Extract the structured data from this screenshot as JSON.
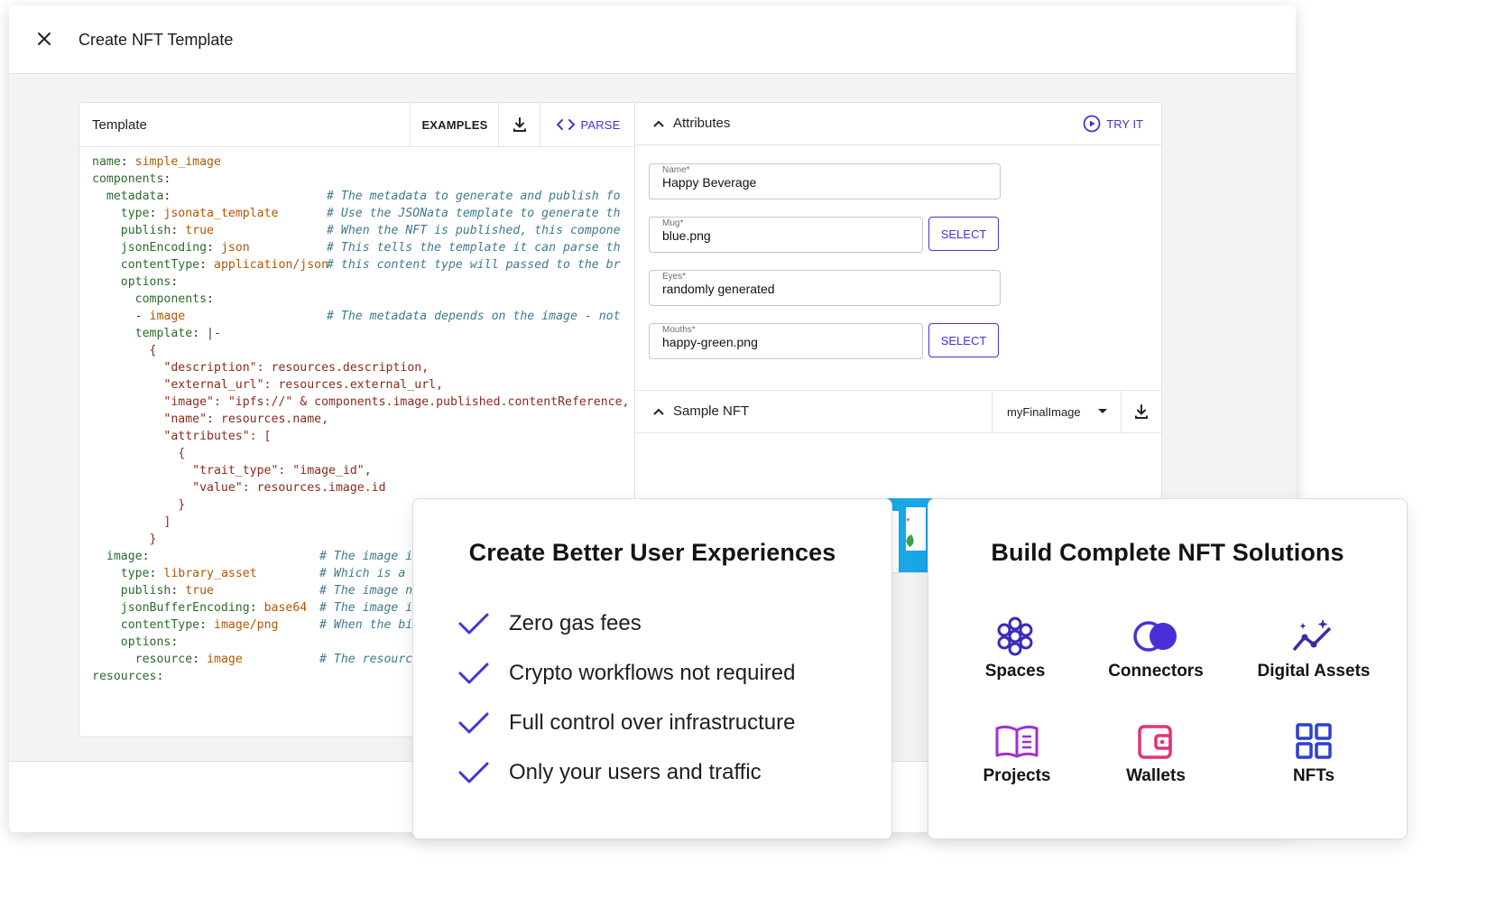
{
  "dialog": {
    "title": "Create NFT Template"
  },
  "template_panel": {
    "title": "Template",
    "examples_label": "EXAMPLES",
    "parse_label": "PARSE",
    "code": [
      [
        [
          "k",
          "name"
        ],
        [
          "p",
          ": "
        ],
        [
          "v",
          "simple_image"
        ]
      ],
      [
        [
          "k",
          "components"
        ],
        [
          "p",
          ":"
        ]
      ],
      [
        [
          "p",
          "  "
        ],
        [
          "k",
          "metadata"
        ],
        [
          "p",
          ":"
        ],
        [
          "c",
          "# The metadata to generate and publish fo",
          260
        ]
      ],
      [
        [
          "p",
          "    "
        ],
        [
          "k",
          "type"
        ],
        [
          "p",
          ": "
        ],
        [
          "v",
          "jsonata_template"
        ],
        [
          "c",
          "# Use the JSONata template to generate th",
          260
        ]
      ],
      [
        [
          "p",
          "    "
        ],
        [
          "k",
          "publish"
        ],
        [
          "p",
          ": "
        ],
        [
          "v",
          "true"
        ],
        [
          "c",
          "# When the NFT is published, this compone",
          260
        ]
      ],
      [
        [
          "p",
          "    "
        ],
        [
          "k",
          "jsonEncoding"
        ],
        [
          "p",
          ": "
        ],
        [
          "v",
          "json"
        ],
        [
          "c",
          "# This tells the template it can parse th",
          260
        ]
      ],
      [
        [
          "p",
          "    "
        ],
        [
          "k",
          "contentType"
        ],
        [
          "p",
          ": "
        ],
        [
          "v",
          "application/json"
        ],
        [
          "c",
          "# this content type will passed to the br",
          260
        ]
      ],
      [
        [
          "p",
          "    "
        ],
        [
          "k",
          "options"
        ],
        [
          "p",
          ":"
        ]
      ],
      [
        [
          "p",
          "      "
        ],
        [
          "k",
          "components"
        ],
        [
          "p",
          ":"
        ]
      ],
      [
        [
          "p",
          "      - "
        ],
        [
          "v",
          "image"
        ],
        [
          "c",
          "# The metadata depends on the image - not",
          260
        ]
      ],
      [
        [
          "p",
          "      "
        ],
        [
          "k",
          "template"
        ],
        [
          "p",
          ": |-"
        ]
      ],
      [
        [
          "p",
          "        "
        ],
        [
          "s",
          "{"
        ]
      ],
      [
        [
          "p",
          "          "
        ],
        [
          "s",
          "\"description\": resources.description,"
        ]
      ],
      [
        [
          "p",
          "          "
        ],
        [
          "s",
          "\"external_url\": resources.external_url,"
        ]
      ],
      [
        [
          "p",
          "          "
        ],
        [
          "s",
          "\"image\": \"ipfs://\" & components.image.published.contentReference,"
        ]
      ],
      [
        [
          "p",
          "          "
        ],
        [
          "s",
          "\"name\": resources.name,"
        ]
      ],
      [
        [
          "p",
          "          "
        ],
        [
          "s",
          "\"attributes\": ["
        ]
      ],
      [
        [
          "p",
          "            "
        ],
        [
          "s",
          "{"
        ]
      ],
      [
        [
          "p",
          "              "
        ],
        [
          "s",
          "\"trait_type\": \"image_id\","
        ]
      ],
      [
        [
          "p",
          "              "
        ],
        [
          "s",
          "\"value\": resources.image.id"
        ]
      ],
      [
        [
          "p",
          "            "
        ],
        [
          "s",
          "}"
        ]
      ],
      [
        [
          "p",
          "          "
        ],
        [
          "s",
          "]"
        ]
      ],
      [
        [
          "p",
          "        "
        ],
        [
          "s",
          "}"
        ]
      ],
      [
        [
          "p",
          "  "
        ],
        [
          "k",
          "image"
        ],
        [
          "p",
          ":"
        ],
        [
          "c",
          "# The image it",
          252
        ]
      ],
      [
        [
          "p",
          "    "
        ],
        [
          "k",
          "type"
        ],
        [
          "p",
          ": "
        ],
        [
          "v",
          "library_asset"
        ],
        [
          "c",
          "# Which is a b",
          252
        ]
      ],
      [
        [
          "p",
          "    "
        ],
        [
          "k",
          "publish"
        ],
        [
          "p",
          ": "
        ],
        [
          "v",
          "true"
        ],
        [
          "c",
          "# The image ne",
          252
        ]
      ],
      [
        [
          "p",
          "    "
        ],
        [
          "k",
          "jsonBufferEncoding"
        ],
        [
          "p",
          ": "
        ],
        [
          "v",
          "base64"
        ],
        [
          "c",
          "# The image is",
          252
        ]
      ],
      [
        [
          "p",
          "    "
        ],
        [
          "k",
          "contentType"
        ],
        [
          "p",
          ": "
        ],
        [
          "v",
          "image/png"
        ],
        [
          "c",
          "# When the bin",
          252
        ]
      ],
      [
        [
          "p",
          "    "
        ],
        [
          "k",
          "options"
        ],
        [
          "p",
          ":"
        ]
      ],
      [
        [
          "p",
          "      "
        ],
        [
          "k",
          "resource"
        ],
        [
          "p",
          ": "
        ],
        [
          "v",
          "image"
        ],
        [
          "c",
          "# The resource",
          252
        ]
      ],
      [
        [
          "k",
          "resources"
        ],
        [
          "p",
          ":"
        ]
      ]
    ]
  },
  "attributes_panel": {
    "title": "Attributes",
    "try_it_label": "TRY IT",
    "fields": [
      {
        "label": "Name*",
        "value": "Happy Beverage",
        "has_select": false
      },
      {
        "label": "Mug*",
        "value": "blue.png",
        "has_select": true
      },
      {
        "label": "Eyes*",
        "value": "randomly generated",
        "has_select": false
      },
      {
        "label": "Mouths*",
        "value": "happy-green.png",
        "has_select": true
      }
    ],
    "select_label": "SELECT",
    "sample_title": "Sample NFT",
    "sample_selected": "myFinalImage"
  },
  "ux_card": {
    "title": "Create Better User Experiences",
    "features": [
      "Zero gas fees",
      "Crypto workflows not required",
      "Full control over infrastructure",
      "Only your users and traffic"
    ],
    "check_color": "#3f35d6"
  },
  "nft_card": {
    "title": "Build Complete NFT Solutions",
    "tiles": [
      {
        "label": "Spaces",
        "icon": "spaces-icon",
        "color": "#3b2bb8"
      },
      {
        "label": "Connectors",
        "icon": "connectors-icon",
        "color": "#4a2fd8"
      },
      {
        "label": "Digital Assets",
        "icon": "digital-assets-icon",
        "color": "#4128a8"
      },
      {
        "label": "Projects",
        "icon": "projects-icon",
        "color": "#a12fd0"
      },
      {
        "label": "Wallets",
        "icon": "wallets-icon",
        "color": "#e0337a"
      },
      {
        "label": "NFTs",
        "icon": "nfts-icon",
        "color": "#2f3fd0"
      }
    ]
  },
  "colors": {
    "accent": "#3f35d6",
    "preview_blue": "#18a8e8"
  }
}
